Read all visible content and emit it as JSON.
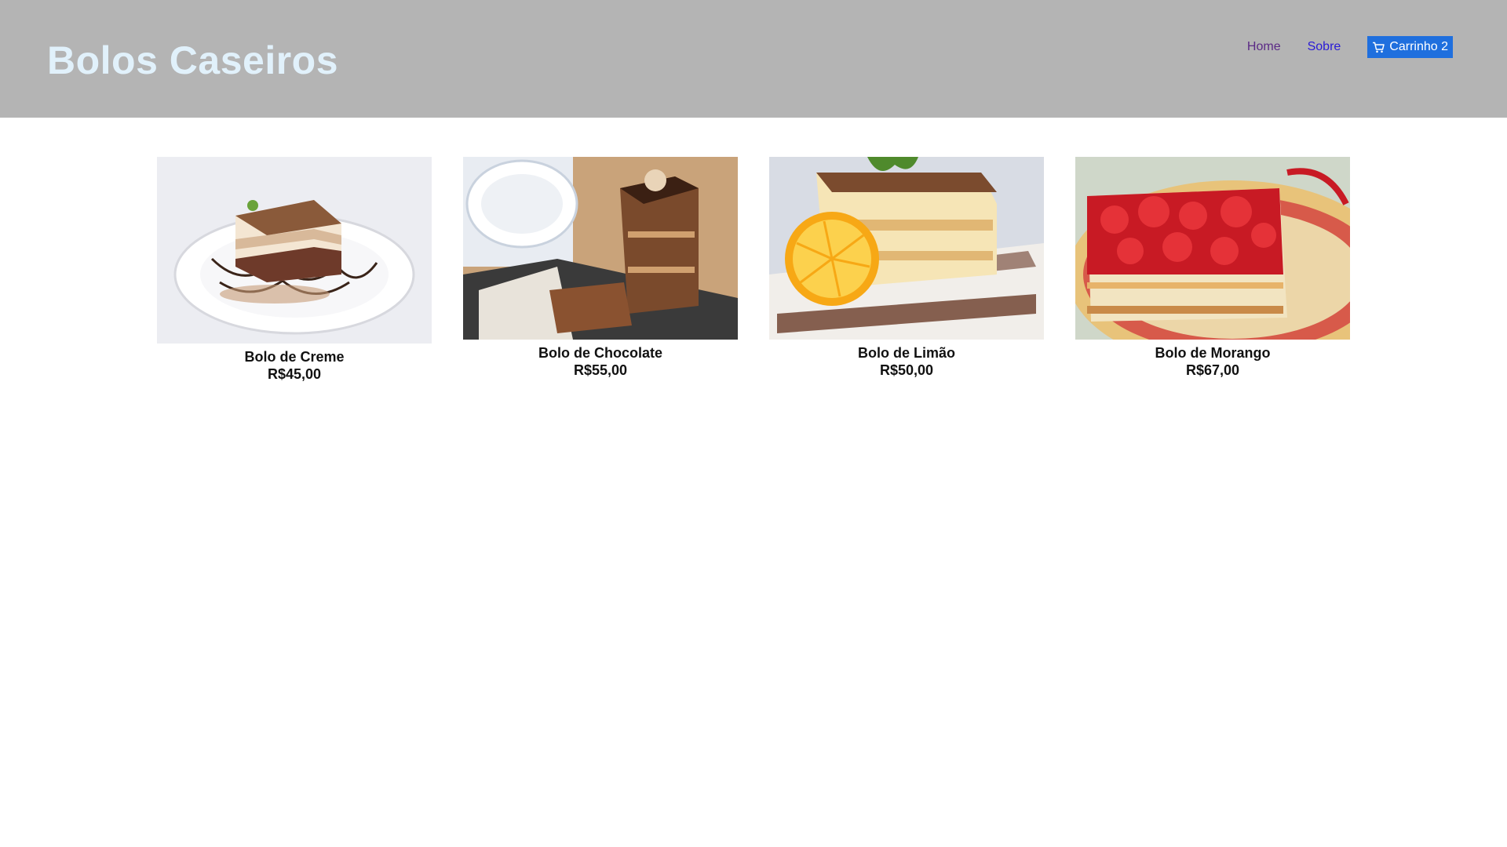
{
  "header": {
    "brand": "Bolos Caseiros",
    "nav": {
      "home": "Home",
      "about": "Sobre",
      "cart_label": "Carrinho 2",
      "cart_icon": "cart-icon"
    }
  },
  "products": [
    {
      "name": "Bolo de Creme",
      "price": "R$45,00",
      "image": "cream-cake-image"
    },
    {
      "name": "Bolo de Chocolate",
      "price": "R$55,00",
      "image": "chocolate-cake-image"
    },
    {
      "name": "Bolo de Limão",
      "price": "R$50,00",
      "image": "lemon-cake-image"
    },
    {
      "name": "Bolo de Morango",
      "price": "R$67,00",
      "image": "strawberry-cake-image"
    }
  ],
  "colors": {
    "header_bg": "#b4b4b4",
    "brand": "#e1f1fb",
    "cart_button": "#1f6fde"
  }
}
